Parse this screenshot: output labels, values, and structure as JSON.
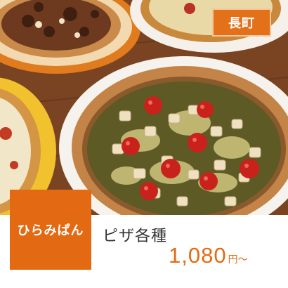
{
  "location_tag": {
    "label": "長町",
    "color": "#e2711a"
  },
  "shop": {
    "name": "ひらみぱん",
    "color": "#e36a12"
  },
  "menu": {
    "item_name": "ピザ各種"
  },
  "price": {
    "amount": "1,080",
    "suffix": "円〜",
    "color": "#e36a12"
  },
  "photo": {
    "subject": "pizza-photo"
  }
}
